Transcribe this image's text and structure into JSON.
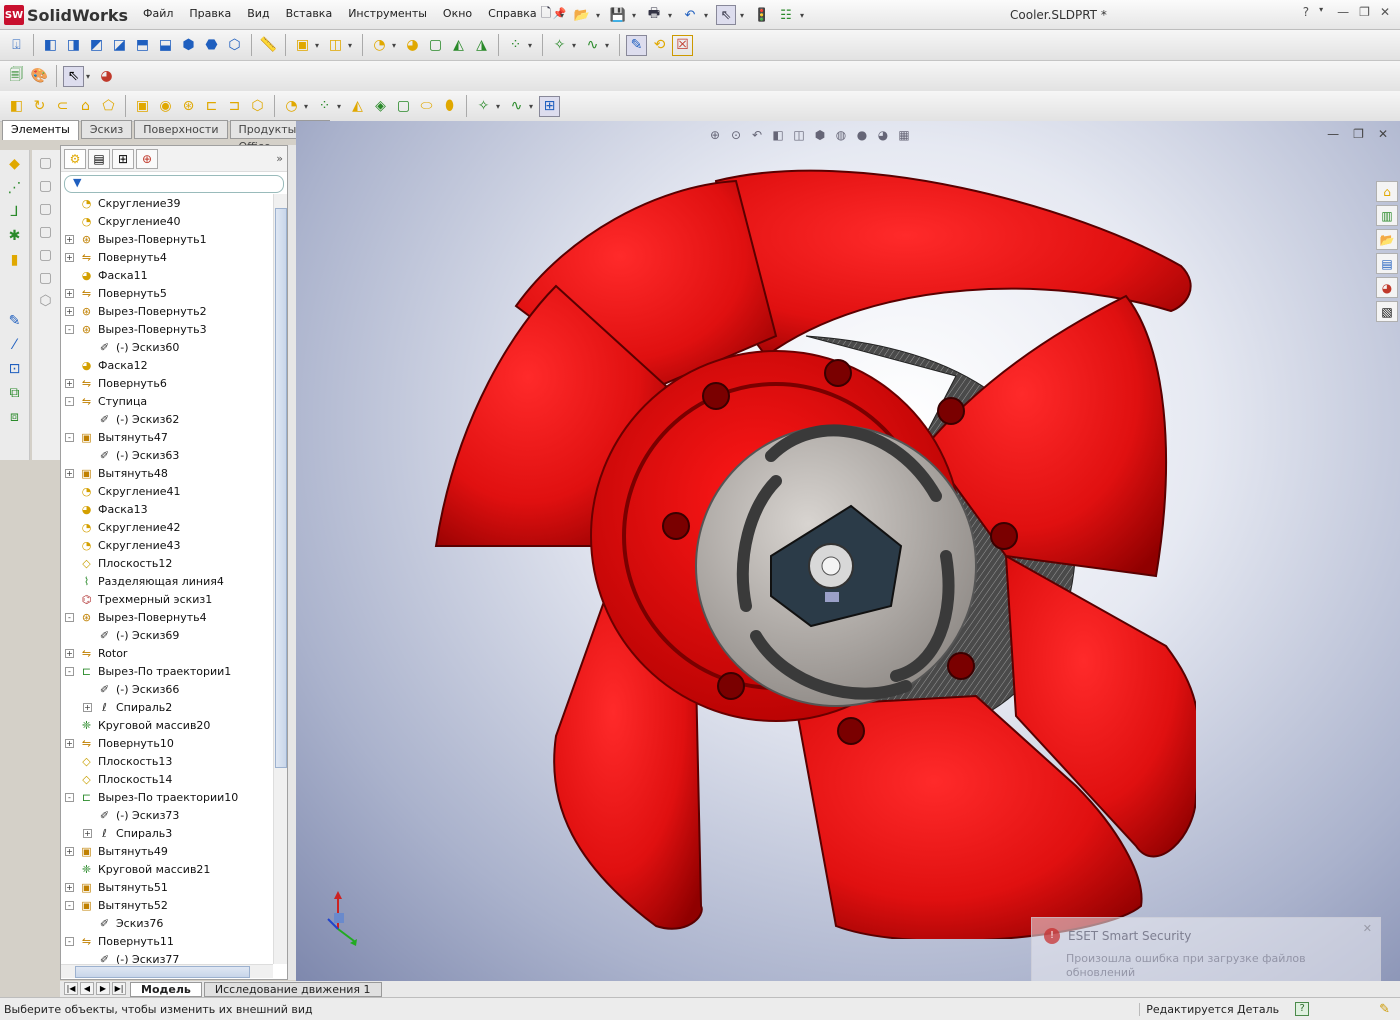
{
  "app": {
    "logo": "SolidWorks",
    "logo_mark": "SW",
    "doc_title": "Cooler.SLDPRT *"
  },
  "menu": [
    "Файл",
    "Правка",
    "Вид",
    "Вставка",
    "Инструменты",
    "Окно",
    "Справка"
  ],
  "cm_tabs": [
    "Элементы",
    "Эскиз",
    "Поверхности",
    "Продукты Office"
  ],
  "tree": [
    {
      "label": "Скругление39",
      "icon": "fillet-icon",
      "level": 0,
      "pm": ""
    },
    {
      "label": "Скругление40",
      "icon": "fillet-icon",
      "level": 0,
      "pm": ""
    },
    {
      "label": "Вырез-Повернуть1",
      "icon": "revolve-cut-icon",
      "level": 0,
      "pm": "+"
    },
    {
      "label": "Повернуть4",
      "icon": "revolve-icon",
      "level": 0,
      "pm": "+"
    },
    {
      "label": "Фаска11",
      "icon": "chamfer-icon",
      "level": 0,
      "pm": ""
    },
    {
      "label": "Повернуть5",
      "icon": "revolve-icon",
      "level": 0,
      "pm": "+"
    },
    {
      "label": "Вырез-Повернуть2",
      "icon": "revolve-cut-icon",
      "level": 0,
      "pm": "+"
    },
    {
      "label": "Вырез-Повернуть3",
      "icon": "revolve-cut-icon",
      "level": 0,
      "pm": "-"
    },
    {
      "label": "(-) Эскиз60",
      "icon": "sketch-icon",
      "level": 1,
      "pm": ""
    },
    {
      "label": "Фаска12",
      "icon": "chamfer-icon",
      "level": 0,
      "pm": ""
    },
    {
      "label": "Повернуть6",
      "icon": "revolve-icon",
      "level": 0,
      "pm": "+"
    },
    {
      "label": "Ступица",
      "icon": "revolve-icon",
      "level": 0,
      "pm": "-"
    },
    {
      "label": "(-) Эскиз62",
      "icon": "sketch-icon",
      "level": 1,
      "pm": ""
    },
    {
      "label": "Вытянуть47",
      "icon": "extrude-icon",
      "level": 0,
      "pm": "-"
    },
    {
      "label": "(-) Эскиз63",
      "icon": "sketch-icon",
      "level": 1,
      "pm": ""
    },
    {
      "label": "Вытянуть48",
      "icon": "extrude-icon",
      "level": 0,
      "pm": "+"
    },
    {
      "label": "Скругление41",
      "icon": "fillet-icon",
      "level": 0,
      "pm": ""
    },
    {
      "label": "Фаска13",
      "icon": "chamfer-icon",
      "level": 0,
      "pm": ""
    },
    {
      "label": "Скругление42",
      "icon": "fillet-icon",
      "level": 0,
      "pm": ""
    },
    {
      "label": "Скругление43",
      "icon": "fillet-icon",
      "level": 0,
      "pm": ""
    },
    {
      "label": "Плоскость12",
      "icon": "plane-icon",
      "level": 0,
      "pm": ""
    },
    {
      "label": "Разделяющая линия4",
      "icon": "split-line-icon",
      "level": 0,
      "pm": ""
    },
    {
      "label": "Трехмерный эскиз1",
      "icon": "3d-sketch-icon",
      "level": 0,
      "pm": ""
    },
    {
      "label": "Вырез-Повернуть4",
      "icon": "revolve-cut-icon",
      "level": 0,
      "pm": "-"
    },
    {
      "label": "(-) Эскиз69",
      "icon": "sketch-icon",
      "level": 1,
      "pm": ""
    },
    {
      "label": "Rotor",
      "icon": "revolve-icon",
      "level": 0,
      "pm": "+"
    },
    {
      "label": "Вырез-По траектории1",
      "icon": "sweep-cut-icon",
      "level": 0,
      "pm": "-"
    },
    {
      "label": "(-) Эскиз66",
      "icon": "sketch-icon",
      "level": 1,
      "pm": ""
    },
    {
      "label": "Спираль2",
      "icon": "helix-icon",
      "level": 1,
      "pm": "+"
    },
    {
      "label": "Круговой массив20",
      "icon": "circular-pattern-icon",
      "level": 0,
      "pm": ""
    },
    {
      "label": "Повернуть10",
      "icon": "revolve-icon",
      "level": 0,
      "pm": "+"
    },
    {
      "label": "Плоскость13",
      "icon": "plane-icon",
      "level": 0,
      "pm": ""
    },
    {
      "label": "Плоскость14",
      "icon": "plane-icon",
      "level": 0,
      "pm": ""
    },
    {
      "label": "Вырез-По траектории10",
      "icon": "sweep-cut-icon",
      "level": 0,
      "pm": "-"
    },
    {
      "label": "(-) Эскиз73",
      "icon": "sketch-icon",
      "level": 1,
      "pm": ""
    },
    {
      "label": "Спираль3",
      "icon": "helix-icon",
      "level": 1,
      "pm": "+"
    },
    {
      "label": "Вытянуть49",
      "icon": "extrude-icon",
      "level": 0,
      "pm": "+"
    },
    {
      "label": "Круговой массив21",
      "icon": "circular-pattern-icon",
      "level": 0,
      "pm": ""
    },
    {
      "label": "Вытянуть51",
      "icon": "extrude-icon",
      "level": 0,
      "pm": "+"
    },
    {
      "label": "Вытянуть52",
      "icon": "extrude-icon",
      "level": 0,
      "pm": "-"
    },
    {
      "label": "Эскиз76",
      "icon": "sketch-icon",
      "level": 1,
      "pm": ""
    },
    {
      "label": "Повернуть11",
      "icon": "revolve-icon",
      "level": 0,
      "pm": "-"
    },
    {
      "label": "(-) Эскиз77",
      "icon": "sketch-icon",
      "level": 1,
      "pm": ""
    }
  ],
  "bottom_tabs": [
    "Модель",
    "Исследование движения 1"
  ],
  "status": {
    "message": "Выберите объекты, чтобы изменить их внешний вид",
    "state": "Редактируется Деталь",
    "help": "?"
  },
  "notification": {
    "title": "ESET Smart Security",
    "message": "Произошла ошибка при загрузке файлов обновлений",
    "close": "✕"
  },
  "colors": {
    "fan": "#e01010",
    "fan_dark": "#8a0000",
    "accent": "#c8102e"
  }
}
